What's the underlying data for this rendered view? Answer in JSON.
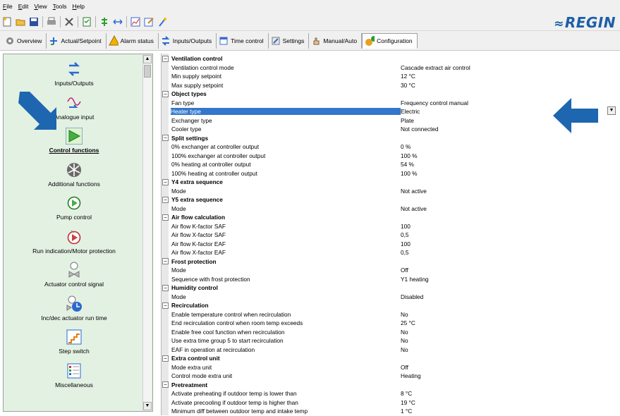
{
  "menu": [
    "File",
    "Edit",
    "View",
    "Tools",
    "Help"
  ],
  "brand": {
    "name": "REGIN",
    "color": "#1b5fa8"
  },
  "toolbar_icons": [
    "new-icon",
    "open-icon",
    "save-icon",
    "print-icon",
    "delete-icon",
    "properties-icon",
    "connect-icon",
    "transfer-icon",
    "chart-icon",
    "edit-icon",
    "wizard-icon"
  ],
  "tabs": [
    {
      "label": "Overview",
      "icon": "overview-icon"
    },
    {
      "label": "Actual/Setpoint",
      "icon": "actual-setpoint-icon"
    },
    {
      "label": "Alarm status",
      "icon": "alarm-bell-icon"
    },
    {
      "label": "Inputs/Outputs",
      "icon": "io-arrows-icon"
    },
    {
      "label": "Time control",
      "icon": "calendar-icon"
    },
    {
      "label": "Settings",
      "icon": "settings-icon"
    },
    {
      "label": "Manual/Auto",
      "icon": "hand-icon"
    },
    {
      "label": "Configuration",
      "icon": "configuration-icon"
    }
  ],
  "left_nav": [
    {
      "label": "Inputs/Outputs",
      "icon": "io-arrows-icon"
    },
    {
      "label": "Analogue input",
      "icon": "analogue-input-icon"
    },
    {
      "label": "Control functions",
      "icon": "control-functions-icon",
      "selected": true
    },
    {
      "label": "Additional functions",
      "icon": "fan-icon"
    },
    {
      "label": "Pump control",
      "icon": "pump-icon"
    },
    {
      "label": "Run indication/Motor protection",
      "icon": "motor-icon"
    },
    {
      "label": "Actuator control signal",
      "icon": "actuator-icon"
    },
    {
      "label": "Inc/dec actuator run time",
      "icon": "actuator-clock-icon"
    },
    {
      "label": "Step switch",
      "icon": "step-switch-icon"
    },
    {
      "label": "Miscellaneous",
      "icon": "miscellaneous-icon"
    }
  ],
  "rows": [
    {
      "type": "cat",
      "label": "Ventilation control"
    },
    {
      "label": "Ventilation control mode",
      "value": "Cascade extract air control"
    },
    {
      "label": "Min supply setpoint",
      "value": "12 °C"
    },
    {
      "label": "Max supply setpoint",
      "value": "30 °C"
    },
    {
      "type": "cat",
      "label": "Object types"
    },
    {
      "label": "Fan type",
      "value": "Frequency control manual"
    },
    {
      "label": "Heater type",
      "value": "Electric",
      "highlight": true
    },
    {
      "label": "Exchanger type",
      "value": "Plate"
    },
    {
      "label": "Cooler type",
      "value": "Not connected"
    },
    {
      "type": "cat",
      "label": "Split settings"
    },
    {
      "label": "0% exchanger at controller output",
      "value": "0 %"
    },
    {
      "label": "100% exchanger at controller output",
      "value": "100 %"
    },
    {
      "label": "0% heating at controller output",
      "value": "54 %"
    },
    {
      "label": "100% heating at controller output",
      "value": "100 %"
    },
    {
      "type": "cat",
      "label": "Y4 extra sequence"
    },
    {
      "label": "Mode",
      "value": "Not active"
    },
    {
      "type": "cat",
      "label": "Y5 extra sequence"
    },
    {
      "label": "Mode",
      "value": "Not active"
    },
    {
      "type": "cat",
      "label": "Air flow calculation"
    },
    {
      "label": "Air flow K-factor SAF",
      "value": "100"
    },
    {
      "label": "Air flow X-factor SAF",
      "value": "0,5"
    },
    {
      "label": "Air flow K-factor EAF",
      "value": "100"
    },
    {
      "label": "Air flow X-factor EAF",
      "value": "0,5"
    },
    {
      "type": "cat",
      "label": "Frost protection"
    },
    {
      "label": "Mode",
      "value": "Off"
    },
    {
      "label": "Sequence with frost protection",
      "value": "Y1 heating"
    },
    {
      "type": "cat",
      "label": "Humidity control"
    },
    {
      "label": "Mode",
      "value": "Disabled"
    },
    {
      "type": "cat",
      "label": "Recirculation"
    },
    {
      "label": "Enable temperature control when recirculation",
      "value": "No"
    },
    {
      "label": "End recirculation control when room temp exceeds",
      "value": "25 °C"
    },
    {
      "label": "Enable free cool function when recirculation",
      "value": "No"
    },
    {
      "label": "Use extra time group 5 to start recirculation",
      "value": "No"
    },
    {
      "label": "EAF in operation at recirculation",
      "value": "No"
    },
    {
      "type": "cat",
      "label": "Extra control unit"
    },
    {
      "label": "Mode extra unit",
      "value": "Off"
    },
    {
      "label": "Control mode extra unit",
      "value": "Heating"
    },
    {
      "type": "cat",
      "label": "Pretreatment"
    },
    {
      "label": "Activate preheating if outdoor temp is lower than",
      "value": "8 °C"
    },
    {
      "label": "Activate precooling if outdoor temp is higher than",
      "value": "19 °C"
    },
    {
      "label": "Minimum diff between outdoor temp and intake temp",
      "value": "1 °C"
    }
  ],
  "colors": {
    "highlight": "#3377cc",
    "left_panel_bg": "#e3f1e3",
    "arrow": "#1e66b0"
  }
}
